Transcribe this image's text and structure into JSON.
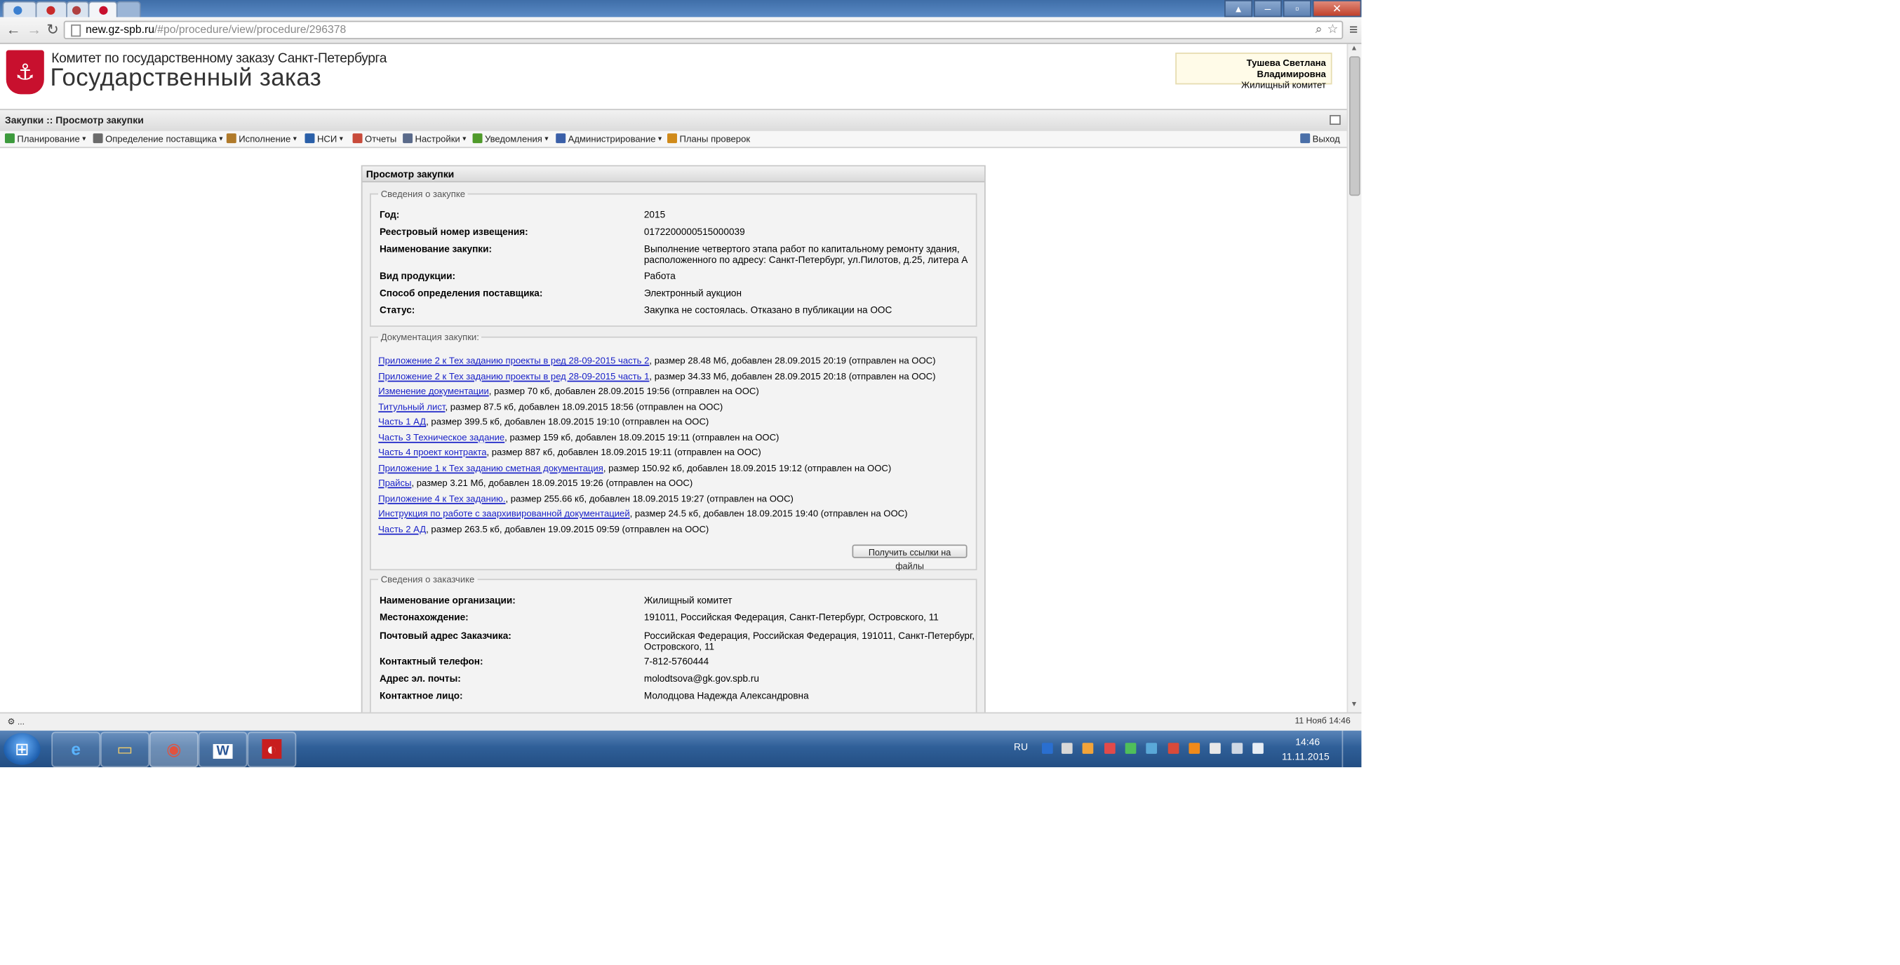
{
  "browser": {
    "url_host": "new.gz-spb.ru",
    "url_path": "/#po/procedure/view/procedure/296378"
  },
  "header": {
    "org_line": "Комитет по государственному заказу Санкт-Петербурга",
    "system_name": "Государственный заказ",
    "user_name": "Тушева Светлана Владимировна",
    "user_org": "Жилищный комитет"
  },
  "breadcrumb": "Закупки :: Просмотр закупки",
  "menu": {
    "items": [
      {
        "label": "Планирование",
        "icon": "planning-icon",
        "color": "#3c9a3c",
        "dropdown": true
      },
      {
        "label": "Определение поставщика",
        "icon": "supplier-icon",
        "color": "#6a6a6a",
        "dropdown": true
      },
      {
        "label": "Исполнение",
        "icon": "execution-icon",
        "color": "#b07a2a",
        "dropdown": true
      },
      {
        "label": "НСИ",
        "icon": "reference-icon",
        "color": "#2a5fa8",
        "dropdown": true
      },
      {
        "label": "Отчеты",
        "icon": "reports-icon",
        "color": "#c84a3a",
        "dropdown": false
      },
      {
        "label": "Настройки",
        "icon": "settings-icon",
        "color": "#5a6a8a",
        "dropdown": true
      },
      {
        "label": "Уведомления",
        "icon": "notifications-icon",
        "color": "#4f9a2a",
        "dropdown": true
      },
      {
        "label": "Администрирование",
        "icon": "admin-icon",
        "color": "#3a5fa8",
        "dropdown": true
      },
      {
        "label": "Планы проверок",
        "icon": "inspection-icon",
        "color": "#d08a1a",
        "dropdown": false
      }
    ],
    "logout": "Выход"
  },
  "panel": {
    "title": "Просмотр закупки",
    "purchase": {
      "legend": "Сведения о закупке",
      "fields": [
        {
          "label": "Год:",
          "value": "2015"
        },
        {
          "label": "Реестровый номер извещения:",
          "value": "0172200000515000039"
        },
        {
          "label": "Наименование закупки:",
          "value": "Выполнение четвертого этапа работ по капитальному ремонту здания, расположенного по адресу: Санкт-Петербург, ул.Пилотов, д.25, литера А"
        },
        {
          "label": "Вид продукции:",
          "value": "Работа"
        },
        {
          "label": "Способ определения поставщика:",
          "value": "Электронный аукцион"
        },
        {
          "label": "Статус:",
          "value": "Закупка не состоялась. Отказано в публикации на ООС"
        }
      ]
    },
    "documents": {
      "legend": "Документация закупки:",
      "items": [
        {
          "name": "Приложение 2 к Тех заданию проекты в ред 28-09-2015 часть 2",
          "info": ", размер 28.48 Мб, добавлен 28.09.2015 20:19 (отправлен на ООС)"
        },
        {
          "name": "Приложение 2 к Тех заданию проекты в ред 28-09-2015 часть 1",
          "info": ", размер 34.33 Мб, добавлен 28.09.2015 20:18 (отправлен на ООС)"
        },
        {
          "name": "Изменение документации",
          "info": ", размер 70 кб, добавлен 28.09.2015 19:56 (отправлен на ООС)"
        },
        {
          "name": "Титульный лист",
          "info": ", размер 87.5 кб, добавлен 18.09.2015 18:56 (отправлен на ООС)"
        },
        {
          "name": "Часть 1 АД",
          "info": ", размер 399.5 кб, добавлен 18.09.2015 19:10 (отправлен на ООС)"
        },
        {
          "name": "Часть 3 Техническое задание",
          "info": ", размер 159 кб, добавлен 18.09.2015 19:11 (отправлен на ООС)"
        },
        {
          "name": "Часть 4 проект контракта",
          "info": ", размер 887 кб, добавлен 18.09.2015 19:11 (отправлен на ООС)"
        },
        {
          "name": "Приложение 1 к Тех заданию сметная документация",
          "info": ", размер 150.92 кб, добавлен 18.09.2015 19:12 (отправлен на ООС)"
        },
        {
          "name": "Прайсы",
          "info": ", размер 3.21 Мб, добавлен 18.09.2015 19:26 (отправлен на ООС)"
        },
        {
          "name": "Приложение 4 к Тех заданию.",
          "info": ", размер 255.66 кб, добавлен 18.09.2015 19:27 (отправлен на ООС)"
        },
        {
          "name": "Инструкция по работе с заархивированной документацией",
          "info": ", размер 24.5 кб, добавлен 18.09.2015 19:40 (отправлен на ООС)"
        },
        {
          "name": "Часть 2 АД",
          "info": ", размер 263.5 кб, добавлен 19.09.2015 09:59 (отправлен на ООС)"
        }
      ],
      "get_links_button": "Получить ссылки на файлы"
    },
    "customer": {
      "legend": "Сведения о заказчике",
      "fields": [
        {
          "label": "Наименование организации:",
          "value": "Жилищный комитет"
        },
        {
          "label": "Местонахождение:",
          "value": "191011, Российская Федерация, Санкт-Петербург, Островского, 11"
        },
        {
          "label": "Почтовый адрес Заказчика:",
          "value": "Российская Федерация, Российская Федерация, 191011, Санкт-Петербург, Островского, 11"
        },
        {
          "label": "Контактный телефон:",
          "value": "7-812-5760444"
        },
        {
          "label": "Адрес эл. почты:",
          "value": "molodtsova@gk.gov.spb.ru"
        },
        {
          "label": "Контактное лицо:",
          "value": "Молодцова Надежда Александровна"
        }
      ]
    }
  },
  "statusbar": {
    "left": "...",
    "date": "11 Нояб 14:46"
  },
  "taskbar": {
    "lang": "RU",
    "time": "14:46",
    "date": "11.11.2015",
    "apps": [
      {
        "name": "ie-icon",
        "glyph": "e",
        "color": "#3a9ad9"
      },
      {
        "name": "explorer-icon",
        "glyph": "▭",
        "color": "#e8c25a"
      },
      {
        "name": "chrome-icon",
        "glyph": "◉",
        "color": "#d9412f"
      },
      {
        "name": "word-icon",
        "glyph": "W",
        "color": "#2b5797"
      },
      {
        "name": "app-red-icon",
        "glyph": "◐",
        "color": "#c81e1e"
      }
    ]
  }
}
